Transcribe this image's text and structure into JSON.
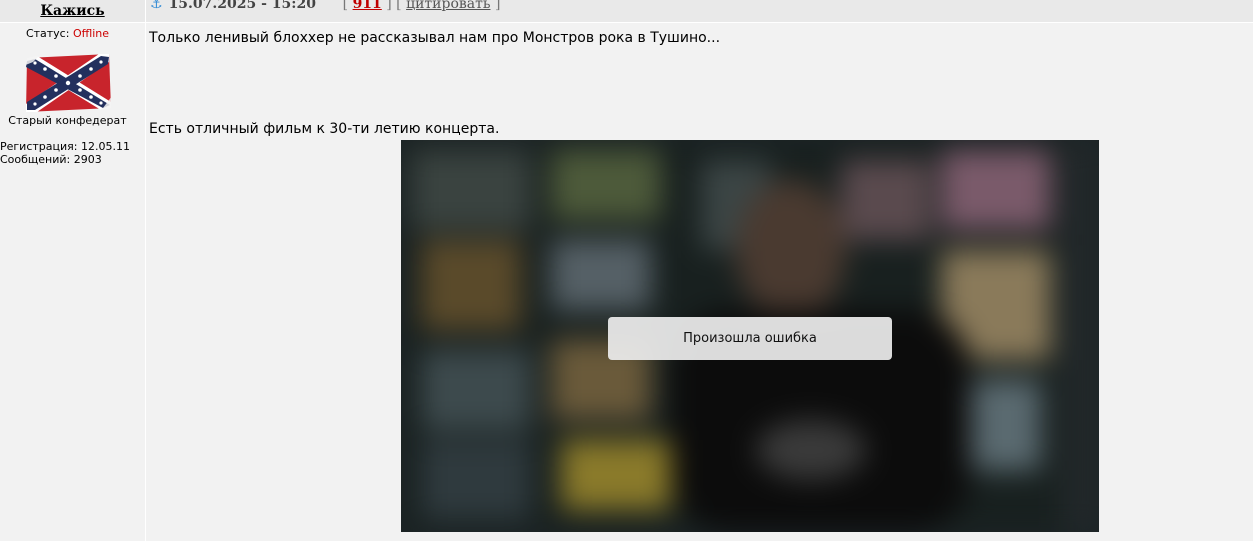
{
  "post": {
    "author": "Кажись",
    "date": "15.07.2025 - 15:20",
    "number": "911",
    "quote_label": "цитировать",
    "bracket_open": "[",
    "bracket_mid": "] [",
    "bracket_close": "]"
  },
  "user": {
    "status_label": "Статус:",
    "status_value": "Offline",
    "title": "Старый конфедерат",
    "registration": "Регистрация: 12.05.11",
    "messages": "Сообщений: 2903"
  },
  "content": {
    "line1": "Только ленивый блоххер не рассказывал нам про Монстров рока в Тушино...",
    "line2": "Есть отличный фильм к 30-ти летию концерта."
  },
  "video": {
    "error_text": "Произошла ошибка"
  },
  "icons": {
    "anchor": "anchor-icon",
    "avatar": "confederate-flag"
  },
  "colors": {
    "offline": "#cc0000",
    "post_number": "#c00000",
    "anchor": "#3a8fd6"
  }
}
